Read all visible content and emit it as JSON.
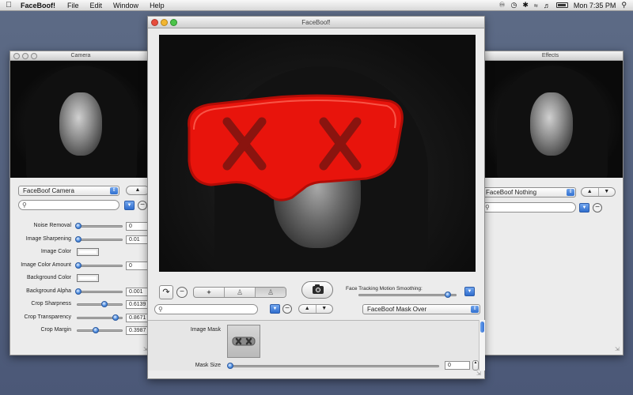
{
  "menubar": {
    "app_name": "FaceBoof!",
    "menus": [
      "File",
      "Edit",
      "Window",
      "Help"
    ],
    "clock": "Mon 7:35 PM"
  },
  "camera_window": {
    "title": "Camera",
    "source_select": "FaceBoof Camera",
    "params": [
      {
        "label": "Noise Removal",
        "kind": "slider",
        "value": "0",
        "slider_fraction": 0.0
      },
      {
        "label": "Image Sharpening",
        "kind": "slider",
        "value": "0.01",
        "slider_fraction": 0.0
      },
      {
        "label": "Image Color",
        "kind": "color",
        "value": "#ffffff"
      },
      {
        "label": "Image Color Amount",
        "kind": "slider",
        "value": "0",
        "slider_fraction": 0.0
      },
      {
        "label": "Background Color",
        "kind": "color",
        "value": "#ffffff"
      },
      {
        "label": "Background Alpha",
        "kind": "slider",
        "value": "0.001",
        "slider_fraction": 0.0
      },
      {
        "label": "Crop Sharpness",
        "kind": "slider",
        "value": "0.6139",
        "slider_fraction": 0.61
      },
      {
        "label": "Crop Transparency",
        "kind": "slider",
        "value": "0.8671",
        "slider_fraction": 0.87
      },
      {
        "label": "Crop Margin",
        "kind": "slider",
        "value": "0.3987",
        "slider_fraction": 0.4
      }
    ]
  },
  "main_window": {
    "title": "FaceBoof!",
    "tracking_label": "Face Tracking Motion Smoothing:",
    "tracking_fraction": 0.92,
    "effect_select": "FaceBoof Mask Over",
    "image_mask_label": "Image Mask",
    "mask_size_label": "Mask Size",
    "mask_size_value": "0",
    "mask_size_fraction": 0.0
  },
  "effects_window": {
    "title": "Effects",
    "effect_select": "FaceBoof Nothing"
  },
  "colors": {
    "mask_red": "#e8140c",
    "accent_blue": "#3a75d6"
  }
}
